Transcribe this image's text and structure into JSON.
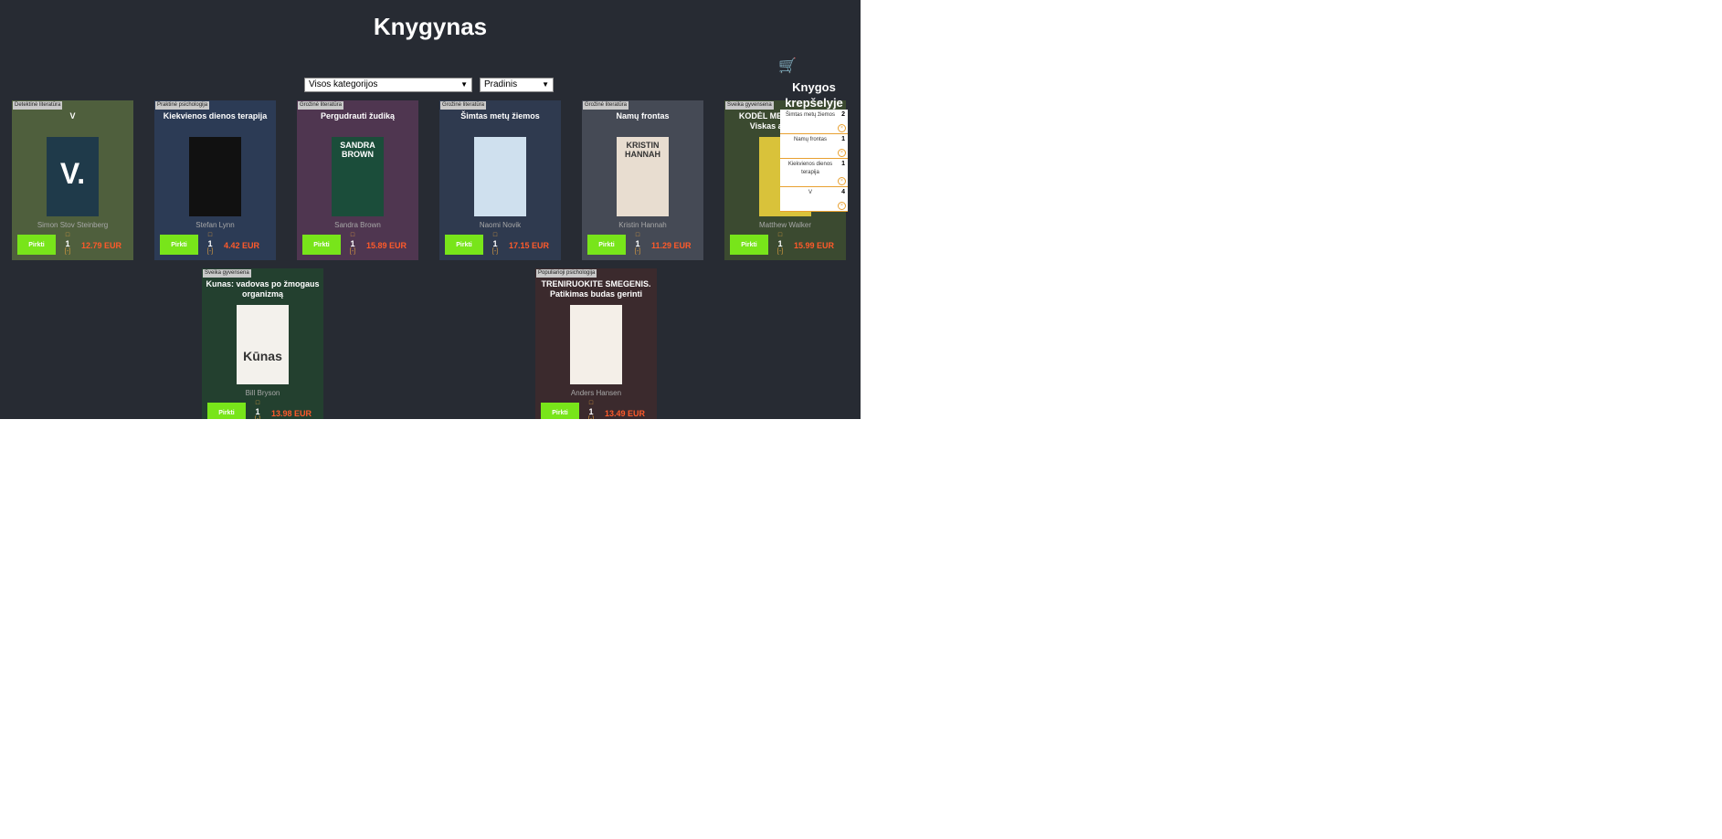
{
  "header": {
    "title": "Knygynas"
  },
  "filters": {
    "category": "Visos kategorijos",
    "sort": "Pradinis"
  },
  "buy_label": "Pirkti",
  "currency": "EUR",
  "books": [
    {
      "category": "Detektinė literatūra",
      "title": "V",
      "author": "Simon Stov Steinberg",
      "quantity": "1",
      "price": "12.79 EUR",
      "bg": "#4f5f3d",
      "cover_bg": "#1f3a4a",
      "cover_text": "V."
    },
    {
      "category": "Praktinė psichologija",
      "title": "Kiekvienos dienos terapija",
      "author": "Stefan Lynn",
      "quantity": "1",
      "price": "4.42 EUR",
      "bg": "#2c3b55",
      "cover_bg": "#111111",
      "cover_text": ""
    },
    {
      "category": "Grožinė literatūra",
      "title": "Pergudrauti žudiką",
      "author": "Sandra Brown",
      "quantity": "1",
      "price": "15.89 EUR",
      "bg": "#4f3650",
      "cover_bg": "#1b4d3a",
      "cover_text": "SANDRA BROWN"
    },
    {
      "category": "Grožinė literatūra",
      "title": "Šimtas metų žiemos",
      "author": "Naomi Novik",
      "quantity": "1",
      "price": "17.15 EUR",
      "bg": "#2f3a4f",
      "cover_bg": "#cfe0ee",
      "cover_text": ""
    },
    {
      "category": "Grožinė literatūra",
      "title": "Namų frontas",
      "author": "Kristin Hannah",
      "quantity": "1",
      "price": "11.29 EUR",
      "bg": "#454a55",
      "cover_bg": "#e8ddd0",
      "cover_text": "KRISTIN HANNAH"
    },
    {
      "category": "Sveika gyvensena",
      "title": "KODĖL MES MIEGAME. Viskas apie miegą",
      "author": "Matthew Walker",
      "quantity": "1",
      "price": "15.99 EUR",
      "bg": "#3b4a30",
      "cover_bg": "#d9c23a",
      "cover_text": ""
    },
    {
      "category": "Sveika gyvensena",
      "title": "Kunas: vadovas po žmogaus organizmą",
      "author": "Bill Bryson",
      "quantity": "1",
      "price": "13.98 EUR",
      "bg": "#23402f",
      "cover_bg": "#f3f1ec",
      "cover_text": "Kūnas"
    },
    {
      "category": "Populiarioji psichologija",
      "title": "TRENIRUOKITE SMEGENIS. Patikimas budas gerinti",
      "author": "Anders Hansen",
      "quantity": "1",
      "price": "13.49 EUR",
      "bg": "#3b2a2d",
      "cover_bg": "#f4efe8",
      "cover_text": ""
    }
  ],
  "cart": {
    "title": "Knygos krepšelyje",
    "items": [
      {
        "name": "Šimtas metų žiemos",
        "qty": "2"
      },
      {
        "name": "Namų frontas",
        "qty": "1"
      },
      {
        "name": "Kiekvienos dienos terapija",
        "qty": "1"
      },
      {
        "name": "V",
        "qty": "4"
      }
    ]
  }
}
